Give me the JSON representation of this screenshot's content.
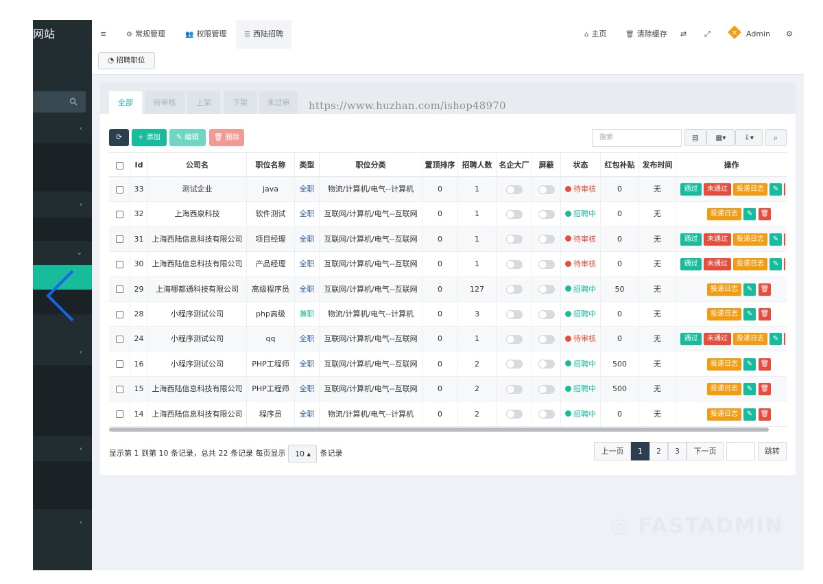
{
  "sidebar": {
    "brand": "网站",
    "search_icon": "search-icon"
  },
  "header": {
    "nav": [
      "常规管理",
      "权限管理",
      "西陆招聘"
    ],
    "right": [
      "主页",
      "清除缓存"
    ],
    "user": "Admin"
  },
  "subtab": "招聘职位",
  "tabs": [
    "全部",
    "待审核",
    "上架",
    "下架",
    "未过审"
  ],
  "watermark": "https://www.huzhan.com/ishop48970",
  "toolbar": {
    "add": "添加",
    "edit": "编辑",
    "delete": "删除",
    "search_placeholder": "搜索"
  },
  "columns": [
    "Id",
    "公司名",
    "职位名称",
    "类型",
    "职位分类",
    "置顶排序",
    "招聘人数",
    "名企大厂",
    "屏蔽",
    "状态",
    "红包补贴",
    "发布时间",
    "操作"
  ],
  "rows": [
    {
      "id": "33",
      "company": "测试企业",
      "job": "java",
      "type": "全职",
      "category": "物流/计算机/电气--计算机",
      "sort": "0",
      "count": "1",
      "status": "待审核",
      "bonus": "0",
      "time": "无"
    },
    {
      "id": "32",
      "company": "上海西泉科技",
      "job": "软件测试",
      "type": "全职",
      "category": "互联网/计算机/电气--互联网",
      "sort": "0",
      "count": "1",
      "status": "招聘中",
      "bonus": "0",
      "time": "无"
    },
    {
      "id": "31",
      "company": "上海西陆信息科技有限公司",
      "job": "项目经理",
      "type": "全职",
      "category": "互联网/计算机/电气--互联网",
      "sort": "0",
      "count": "1",
      "status": "待审核",
      "bonus": "0",
      "time": "无"
    },
    {
      "id": "30",
      "company": "上海西陆信息科技有限公司",
      "job": "产品经理",
      "type": "全职",
      "category": "互联网/计算机/电气--互联网",
      "sort": "0",
      "count": "1",
      "status": "待审核",
      "bonus": "0",
      "time": "无"
    },
    {
      "id": "29",
      "company": "上海哪都通科技有限公司",
      "job": "高级程序员",
      "type": "全职",
      "category": "互联网/计算机/电气--互联网",
      "sort": "0",
      "count": "127",
      "status": "招聘中",
      "bonus": "50",
      "time": "无"
    },
    {
      "id": "28",
      "company": "小程序测试公司",
      "job": "php高级",
      "type": "兼职",
      "category": "物流/计算机/电气--计算机",
      "sort": "0",
      "count": "3",
      "status": "招聘中",
      "bonus": "0",
      "time": "无"
    },
    {
      "id": "24",
      "company": "小程序测试公司",
      "job": "qq",
      "type": "全职",
      "category": "互联网/计算机/电气--互联网",
      "sort": "0",
      "count": "1",
      "status": "待审核",
      "bonus": "0",
      "time": "无"
    },
    {
      "id": "16",
      "company": "小程序测试公司",
      "job": "PHP工程师",
      "type": "全职",
      "category": "互联网/计算机/电气--互联网",
      "sort": "0",
      "count": "2",
      "status": "招聘中",
      "bonus": "500",
      "time": "无"
    },
    {
      "id": "15",
      "company": "上海西陆信息科技有限公司",
      "job": "PHP工程师",
      "type": "全职",
      "category": "互联网/计算机/电气--互联网",
      "sort": "0",
      "count": "2",
      "status": "招聘中",
      "bonus": "500",
      "time": "无"
    },
    {
      "id": "14",
      "company": "上海西陆信息科技有限公司",
      "job": "程序员",
      "type": "全职",
      "category": "物流/计算机/电气--计算机",
      "sort": "0",
      "count": "2",
      "status": "招聘中",
      "bonus": "0",
      "time": "无"
    }
  ],
  "actions": {
    "pass": "通过",
    "fail": "未通过",
    "log": "投递日志"
  },
  "footer": {
    "prefix": "显示第 1 到第 10 条记录，总共 22 条记录 每页显示",
    "page_size": "10",
    "suffix": "条记录"
  },
  "pager": {
    "prev": "上一页",
    "pages": [
      "1",
      "2",
      "3"
    ],
    "next": "下一页",
    "jump": "跳转"
  },
  "colors": {
    "primary": "#18bc9c",
    "dark": "#2c3e50",
    "danger": "#e74c3c",
    "warning": "#f39c12"
  }
}
